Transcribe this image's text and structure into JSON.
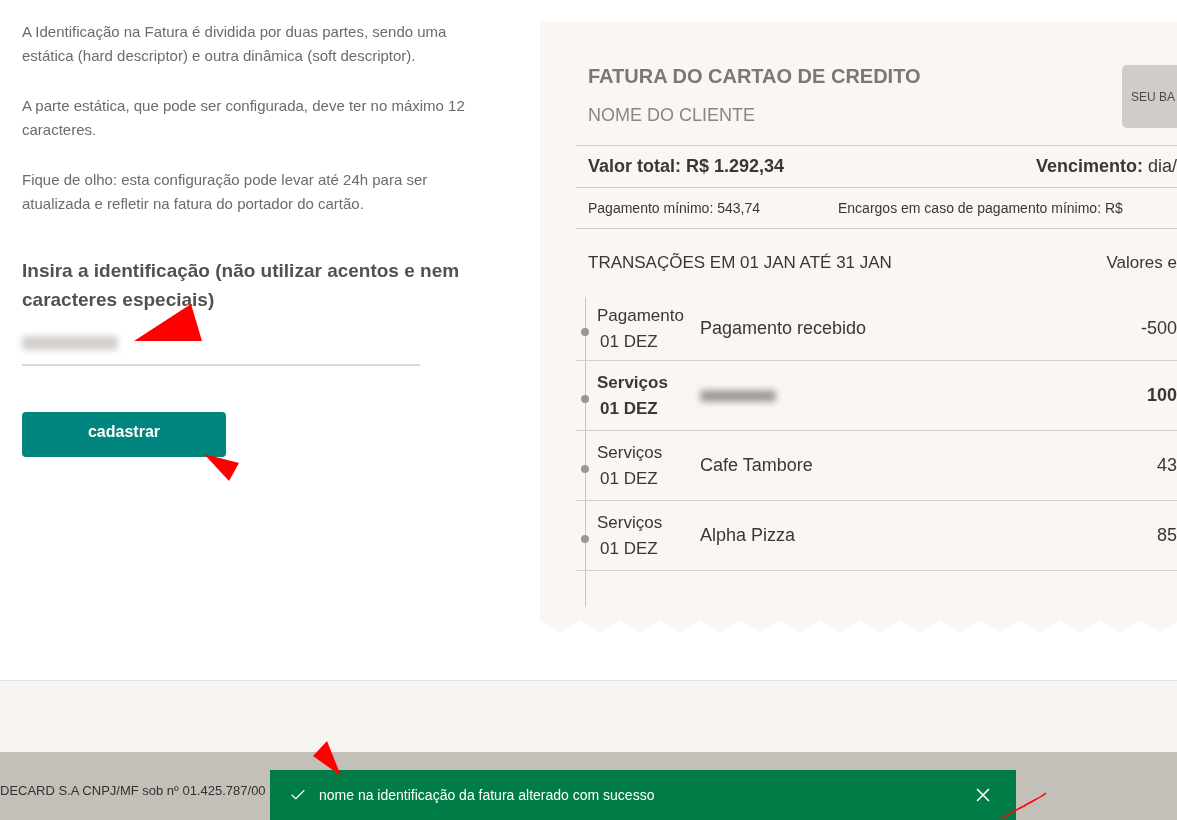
{
  "intro": {
    "paragraphs": [
      "A Identificação na Fatura é dividida por duas partes, sendo uma estática (hard descriptor) e outra dinâmica (soft descriptor).",
      "A parte estática, que pode ser configurada, deve ter no máximo 12 caracteres.",
      "Fique de olho: esta configuração pode levar até 24h para ser atualizada e refletir na fatura do portador do cartão."
    ]
  },
  "form": {
    "label": "Insira a identificação (não utilizar acentos e nem caracteres especiais)",
    "value_blurred": true,
    "submit": "cadastrar"
  },
  "invoice": {
    "title": "FATURA DO CARTAO DE CREDITO",
    "customer": "NOME DO CLIENTE",
    "badge": "SEU BA",
    "total": "Valor total: R$ 1.292,34",
    "due": "**Vencimento:** dia/",
    "minimum": "Pagamento mínimo: 543,74",
    "charges": "Encargos em caso de pagamento mínimo: R$",
    "transactions_title": "TRANSAÇÕES EM 01 JAN ATÉ 31 JAN",
    "values_label": "Valores e",
    "transactions": [
      {
        "category": "Pagamento",
        "date": "01 DEZ",
        "description": "Pagamento recebido",
        "description_blurred": false,
        "amount": "-500",
        "highlighted": false
      },
      {
        "category": "Serviços",
        "date": "01 DEZ",
        "description_blurred": true,
        "amount": "100",
        "highlighted": true
      },
      {
        "category": "Serviços",
        "date": "01 DEZ",
        "description": "Cafe Tambore",
        "description_blurred": false,
        "amount": "43",
        "highlighted": false
      },
      {
        "category": "Serviços",
        "date": "01 DEZ",
        "description": "Alpha Pizza",
        "description_blurred": false,
        "amount": "85",
        "highlighted": false
      }
    ]
  },
  "footer": {
    "company": "DECARD S.A CNPJ/MF sob nº 01.425.787/00"
  },
  "toast": {
    "message": "nome na identificação da fatura alterado com sucesso"
  }
}
